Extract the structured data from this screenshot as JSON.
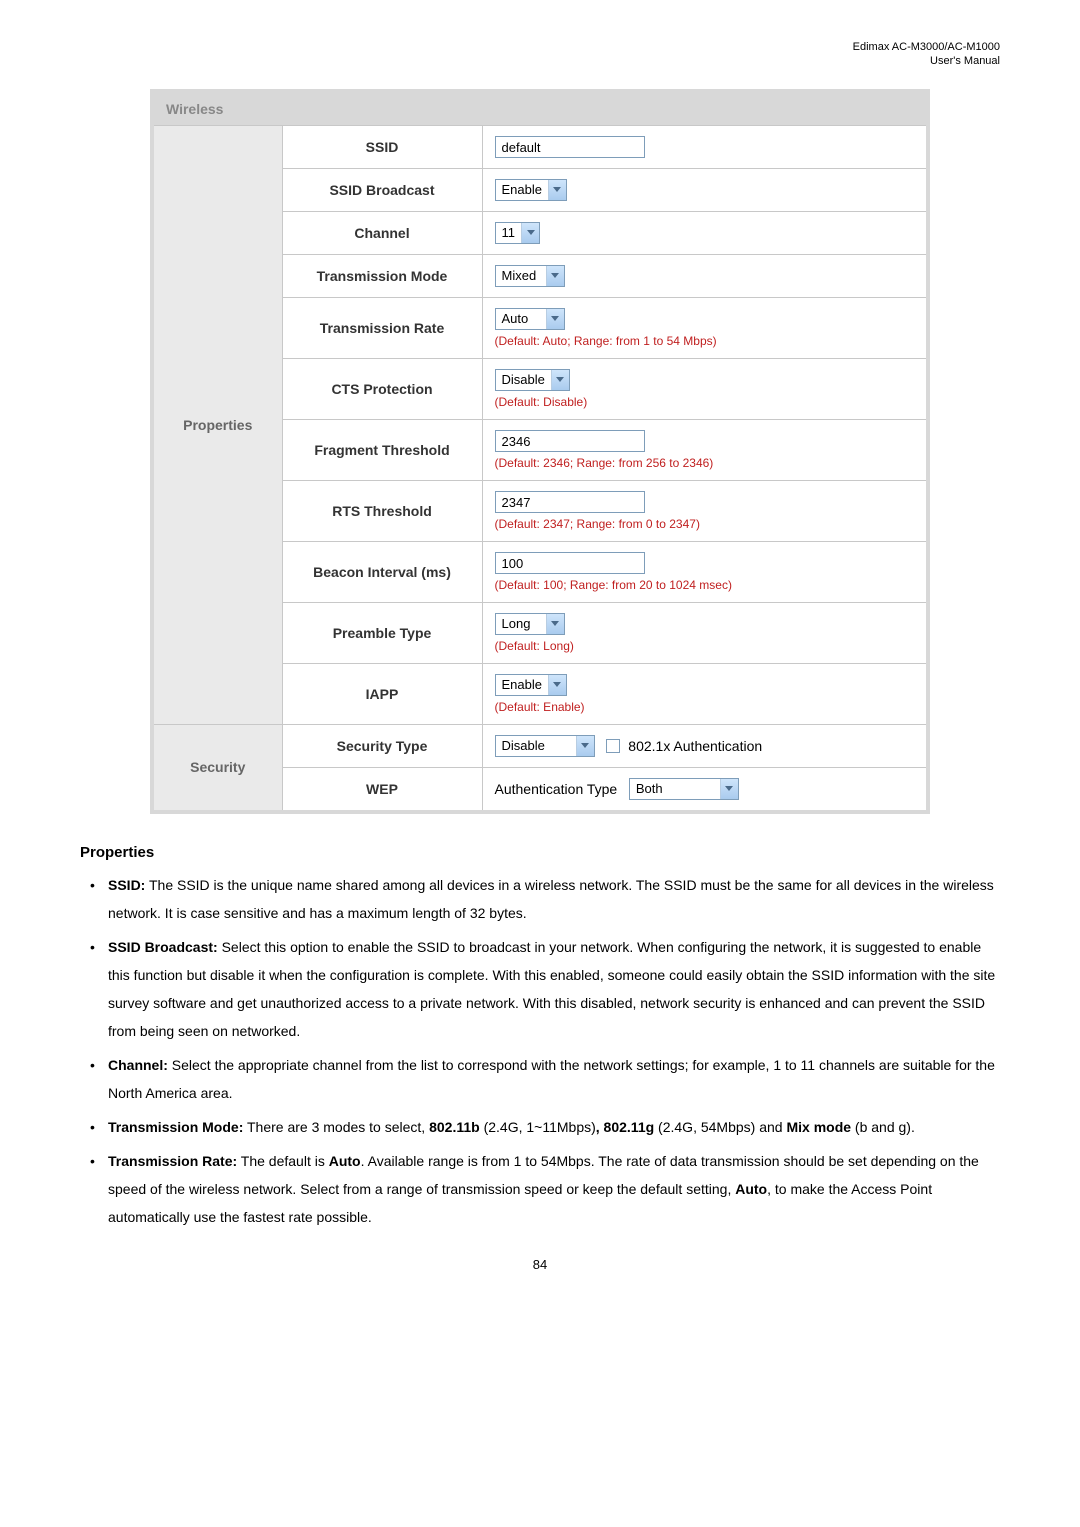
{
  "header": {
    "product": "Edimax AC-M3000/AC-M1000",
    "subtitle": "User's Manual"
  },
  "table": {
    "title": "Wireless",
    "group_properties": "Properties",
    "group_security": "Security",
    "rows": {
      "ssid": {
        "label": "SSID",
        "value": "default"
      },
      "ssid_broadcast": {
        "label": "SSID Broadcast",
        "value": "Enable"
      },
      "channel": {
        "label": "Channel",
        "value": "11"
      },
      "transmission_mode": {
        "label": "Transmission Mode",
        "value": "Mixed"
      },
      "transmission_rate": {
        "label": "Transmission Rate",
        "value": "Auto",
        "hint": "(Default: Auto; Range: from 1 to 54 Mbps)"
      },
      "cts_protection": {
        "label": "CTS Protection",
        "value": "Disable",
        "hint": "(Default: Disable)"
      },
      "fragment_threshold": {
        "label": "Fragment Threshold",
        "value": "2346",
        "hint": "(Default: 2346; Range: from 256 to 2346)"
      },
      "rts_threshold": {
        "label": "RTS Threshold",
        "value": "2347",
        "hint": "(Default: 2347; Range: from 0 to 2347)"
      },
      "beacon_interval": {
        "label": "Beacon Interval (ms)",
        "value": "100",
        "hint": "(Default: 100; Range: from 20 to 1024 msec)"
      },
      "preamble_type": {
        "label": "Preamble Type",
        "value": "Long",
        "hint": "(Default: Long)"
      },
      "iapp": {
        "label": "IAPP",
        "value": "Enable",
        "hint": "(Default: Enable)"
      },
      "security_type": {
        "label": "Security Type",
        "value": "Disable",
        "checkbox_label": "802.1x Authentication"
      },
      "wep": {
        "label": "WEP",
        "auth_label": "Authentication Type",
        "value": "Both"
      }
    }
  },
  "prose": {
    "heading": "Properties",
    "items": [
      {
        "lead": "SSID:",
        "body": " The SSID is the unique name shared among all devices in a wireless network. The SSID must be the same for all devices in the wireless network. It is case sensitive and has a maximum length of 32 bytes."
      },
      {
        "lead": "SSID Broadcast:",
        "body": " Select this option to enable the SSID to broadcast in your network. When configuring the network, it is suggested to enable this function but disable it when the configuration is complete. With this enabled, someone could easily obtain the SSID information with the site survey software and get unauthorized access to a private network. With this disabled, network security is enhanced and can prevent the SSID from being seen on networked."
      },
      {
        "lead": "Channel:",
        "body": " Select the appropriate channel from the list to correspond with the network settings; for example, 1 to 11 channels are suitable for the North America area."
      },
      {
        "lead": "Transmission Mode:",
        "body_parts": [
          " There are 3 modes to select, ",
          "802.11b",
          " (2.4G, 1~11Mbps)",
          ", 802.11g",
          " (2.4G, 54Mbps) and ",
          "Mix mode",
          " (b and g)."
        ]
      },
      {
        "lead": "Transmission Rate:",
        "body_parts": [
          " The default is ",
          "Auto",
          ". Available range is from 1 to 54Mbps. The rate of data transmission should be set depending on the speed of the wireless network. Select from a range of transmission speed or keep the default setting, ",
          "Auto",
          ", to make the Access Point automatically use the fastest rate possible."
        ]
      }
    ]
  },
  "page_number": "84"
}
